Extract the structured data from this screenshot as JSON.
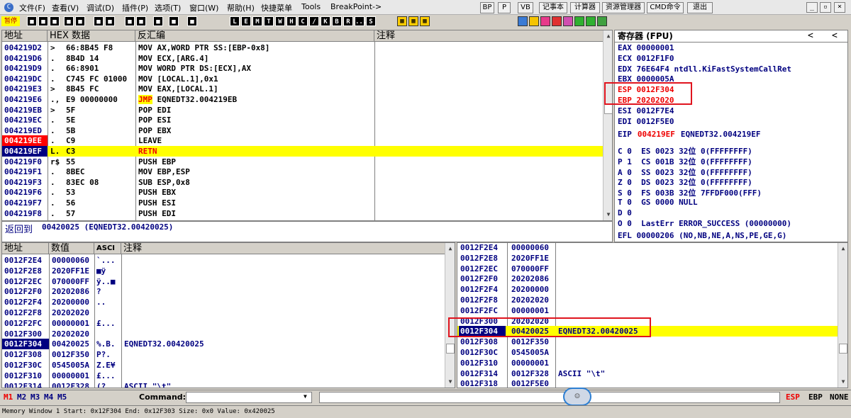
{
  "menu": [
    "文件(F)",
    "查看(V)",
    "调试(D)",
    "插件(P)",
    "选项(T)",
    "窗口(W)",
    "帮助(H)",
    "快捷菜单",
    "Tools",
    "BreakPoint->"
  ],
  "right_buttons": [
    "BP",
    "P",
    "VB",
    "记事本",
    "计算器",
    "资源管理器",
    "CMD命令",
    "退出"
  ],
  "status": "暂停",
  "toolbar_letters": [
    "L",
    "E",
    "M",
    "T",
    "W",
    "H",
    "C",
    "/",
    "K",
    "B",
    "R",
    "...",
    "S"
  ],
  "disasm": {
    "headers": [
      "地址",
      "HEX 数据",
      "反汇编",
      "注释"
    ],
    "rows": [
      {
        "addr": "004219D2",
        "mark": ">",
        "hex": "66:8B45 F8",
        "asm": "MOV AX,WORD PTR SS:[EBP-0x8]"
      },
      {
        "addr": "004219D6",
        "mark": ".",
        "hex": "8B4D 14",
        "asm": "MOV ECX,[ARG.4]"
      },
      {
        "addr": "004219D9",
        "mark": ".",
        "hex": "66:8901",
        "asm": "MOV WORD PTR DS:[ECX],AX"
      },
      {
        "addr": "004219DC",
        "mark": ".",
        "hex": "C745 FC 01000",
        "asm": "MOV [LOCAL.1],0x1"
      },
      {
        "addr": "004219E3",
        "mark": ">",
        "hex": "8B45 FC",
        "asm": "MOV EAX,[LOCAL.1]"
      },
      {
        "addr": "004219E6",
        "mark": ".,",
        "hex": "E9 00000000",
        "asm": "JMP EQNEDT32.004219EB"
      },
      {
        "addr": "004219EB",
        "mark": ">",
        "hex": "5F",
        "asm": "POP EDI"
      },
      {
        "addr": "004219EC",
        "mark": ".",
        "hex": "5E",
        "asm": "POP ESI"
      },
      {
        "addr": "004219ED",
        "mark": ".",
        "hex": "5B",
        "asm": "POP EBX"
      },
      {
        "addr": "004219EE",
        "mark": ".",
        "hex": "C9",
        "asm": "LEAVE"
      },
      {
        "addr": "004219EF",
        "mark": "L.",
        "hex": "C3",
        "asm": "RETN"
      },
      {
        "addr": "004219F0",
        "mark": "r$",
        "hex": "55",
        "asm": "PUSH EBP"
      },
      {
        "addr": "004219F1",
        "mark": ".",
        "hex": "8BEC",
        "asm": "MOV EBP,ESP"
      },
      {
        "addr": "004219F3",
        "mark": ".",
        "hex": "83EC 08",
        "asm": "SUB ESP,0x8"
      },
      {
        "addr": "004219F6",
        "mark": ".",
        "hex": "53",
        "asm": "PUSH EBX"
      },
      {
        "addr": "004219F7",
        "mark": ".",
        "hex": "56",
        "asm": "PUSH ESI"
      },
      {
        "addr": "004219F8",
        "mark": ".",
        "hex": "57",
        "asm": "PUSH EDI"
      }
    ],
    "info_label": "返回到",
    "info_text": "00420025 (EQNEDT32.00420025)"
  },
  "registers": {
    "title": "寄存器 (FPU)",
    "gp": [
      {
        "text": "EAX 00000001"
      },
      {
        "text": "ECX 0012F1F0"
      },
      {
        "text": "EDX 76E64F4 ntdll.KiFastSystemCallRet"
      },
      {
        "text": "EBX 0000005A"
      },
      {
        "text": "ESP 0012F304",
        "red": true
      },
      {
        "text": "EBP 20202020",
        "red": true
      },
      {
        "text": "ESI 0012F7E4"
      },
      {
        "text": "EDI 0012F5E0"
      }
    ],
    "eip_name": "EIP",
    "eip_value": "004219EF",
    "eip_sym": "EQNEDT32.004219EF",
    "flags": [
      "C 0  ES 0023 32位 0(FFFFFFFF)",
      "P 1  CS 001B 32位 0(FFFFFFFF)",
      "A 0  SS 0023 32位 0(FFFFFFFF)",
      "Z 0  DS 0023 32位 0(FFFFFFFF)",
      "S 0  FS 003B 32位 7FFDF000(FFF)",
      "T 0  GS 0000 NULL",
      "D 0",
      "O 0  LastErr ERROR_SUCCESS (00000000)"
    ],
    "efl": "EFL 00000206 (NO,NB,NE,A,NS,PE,GE,G)"
  },
  "dump": {
    "headers": [
      "地址",
      "数值",
      "ASCI",
      "注释"
    ],
    "rows": [
      {
        "addr": "0012F2E4",
        "val": "00000060",
        "ascii": "`...",
        "comment": ""
      },
      {
        "addr": "0012F2E8",
        "val": "2020FF1E",
        "ascii": "■ÿ",
        "comment": ""
      },
      {
        "addr": "0012F2EC",
        "val": "070000FF",
        "ascii": "ÿ..■",
        "comment": ""
      },
      {
        "addr": "0012F2F0",
        "val": "20202086",
        "ascii": "?",
        "comment": ""
      },
      {
        "addr": "0012F2F4",
        "val": "20200000",
        "ascii": "..",
        "comment": ""
      },
      {
        "addr": "0012F2F8",
        "val": "20202020",
        "ascii": "",
        "comment": ""
      },
      {
        "addr": "0012F2FC",
        "val": "00000001",
        "ascii": "£...",
        "comment": ""
      },
      {
        "addr": "0012F300",
        "val": "20202020",
        "ascii": "",
        "comment": ""
      },
      {
        "addr": "0012F304",
        "val": "00420025",
        "ascii": "%.B.",
        "comment": "EQNEDT32.00420025"
      },
      {
        "addr": "0012F308",
        "val": "0012F350",
        "ascii": "P?.",
        "comment": ""
      },
      {
        "addr": "0012F30C",
        "val": "0545005A",
        "ascii": "Z.E¥",
        "comment": ""
      },
      {
        "addr": "0012F310",
        "val": "00000001",
        "ascii": "£...",
        "comment": ""
      },
      {
        "addr": "0012F314",
        "val": "0012F328",
        "ascii": "(?.",
        "comment": "ASCII \"\\t\""
      }
    ]
  },
  "stack": {
    "rows": [
      {
        "addr": "0012F2E4",
        "val": "00000060",
        "comment": ""
      },
      {
        "addr": "0012F2E8",
        "val": "2020FF1E",
        "comment": ""
      },
      {
        "addr": "0012F2EC",
        "val": "070000FF",
        "comment": ""
      },
      {
        "addr": "0012F2F0",
        "val": "20202086",
        "comment": ""
      },
      {
        "addr": "0012F2F4",
        "val": "20200000",
        "comment": ""
      },
      {
        "addr": "0012F2F8",
        "val": "20202020",
        "comment": ""
      },
      {
        "addr": "0012F2FC",
        "val": "00000001",
        "comment": ""
      },
      {
        "addr": "0012F300",
        "val": "20202020",
        "comment": ""
      },
      {
        "addr": "0012F304",
        "val": "00420025",
        "comment": "EQNEDT32.00420025",
        "sel": true
      },
      {
        "addr": "0012F308",
        "val": "0012F350",
        "comment": ""
      },
      {
        "addr": "0012F30C",
        "val": "0545005A",
        "comment": ""
      },
      {
        "addr": "0012F310",
        "val": "00000001",
        "comment": ""
      },
      {
        "addr": "0012F314",
        "val": "0012F328",
        "comment": "ASCII \"\\t\""
      },
      {
        "addr": "0012F318",
        "val": "0012F5E0",
        "comment": ""
      }
    ]
  },
  "cmdbar": {
    "tabs": [
      "M1",
      "M2",
      "M3",
      "M4",
      "M5"
    ],
    "command_label": "Command:",
    "right": [
      "ESP",
      "EBP",
      "NONE"
    ]
  },
  "statusbar": "Memory Window 1  Start: 0x12F304  End: 0x12F303  Size: 0x0 Value: 0x420025"
}
